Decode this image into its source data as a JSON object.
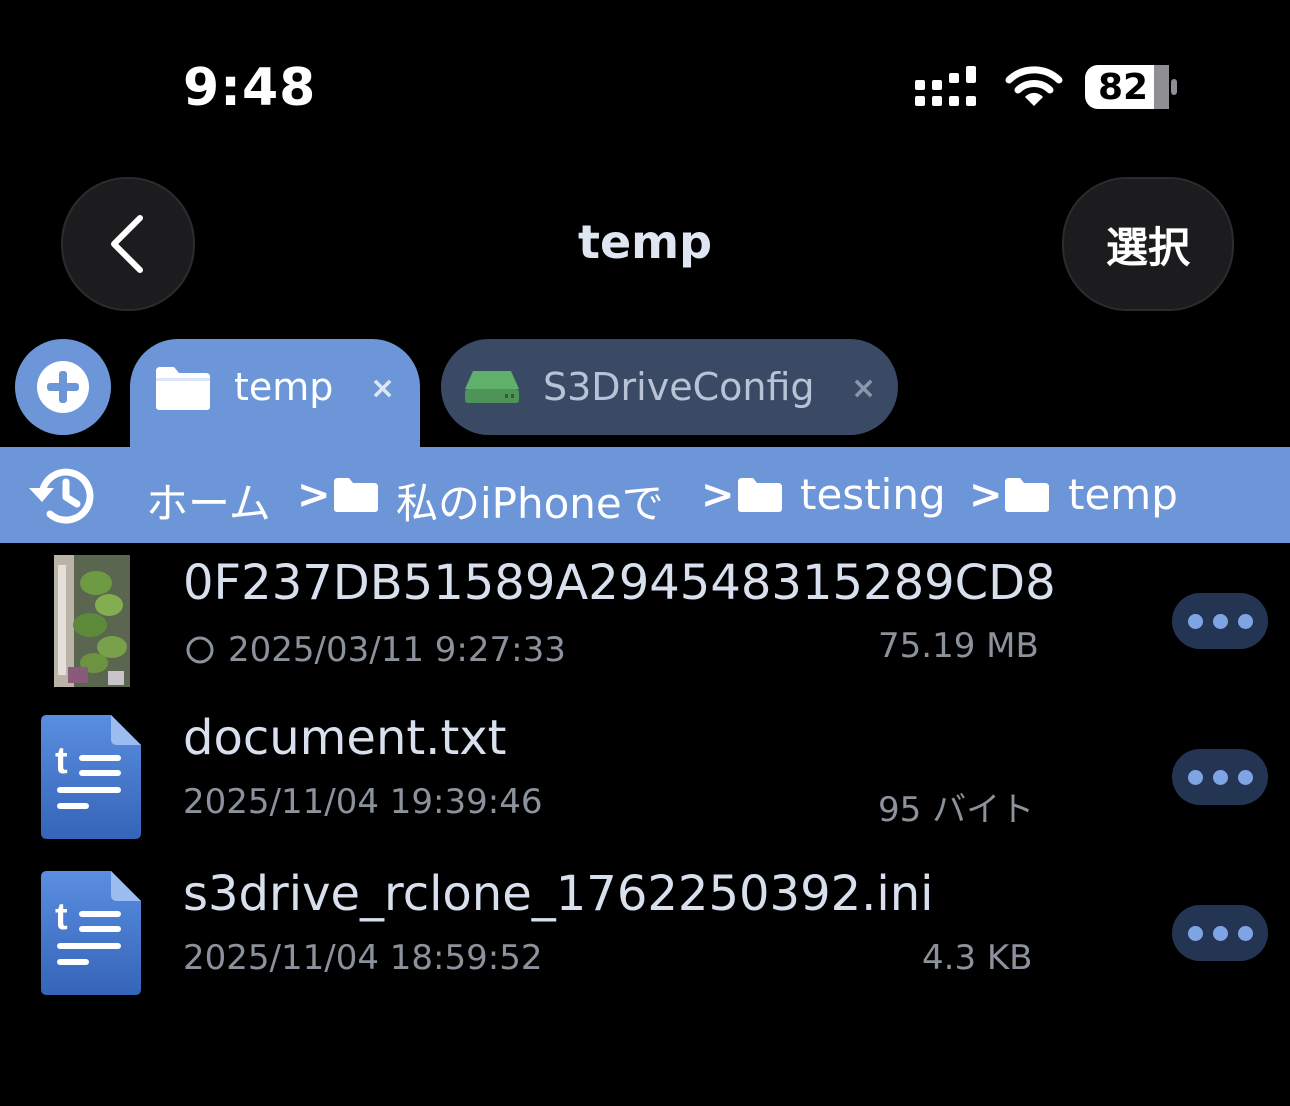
{
  "status_bar": {
    "time": "9:48",
    "battery_level": "82",
    "signal_icon": "signal-icon",
    "wifi_icon": "wifi-icon"
  },
  "nav": {
    "back_icon": "chevron-left-icon",
    "title": "temp",
    "select_label": "選択"
  },
  "tabs": {
    "add_icon": "plus-circle-icon",
    "items": [
      {
        "label": "temp",
        "icon": "folder-icon",
        "close": "×",
        "active": true
      },
      {
        "label": "S3DriveConfig",
        "icon": "drive-icon",
        "close": "×",
        "active": false
      }
    ]
  },
  "breadcrumb": {
    "history_icon": "history-icon",
    "items": [
      {
        "label": "ホーム"
      },
      {
        "label": "私のiPhoneで",
        "icon": "folder-icon"
      },
      {
        "label": "testing",
        "icon": "folder-icon"
      },
      {
        "label": "temp",
        "icon": "folder-icon"
      }
    ],
    "separator": ">"
  },
  "files": [
    {
      "name": "0F237DB51589A294548315289CD8",
      "date": "2025/03/11 9:27:33",
      "size": "75.19 MB",
      "thumb": "photo-thumbnail",
      "status_icon": "circle-outline-icon"
    },
    {
      "name": "document.txt",
      "date": "2025/11/04 19:39:46",
      "size": "95 バイト",
      "thumb": "text-file-icon"
    },
    {
      "name": "s3drive_rclone_1762250392.ini",
      "date": "2025/11/04 18:59:52",
      "size": "4.3 KB",
      "thumb": "text-file-icon"
    }
  ],
  "colors": {
    "accent": "#6d96d8",
    "tab_inactive": "#3a4a65",
    "more_button": "#233552",
    "background": "#000000"
  }
}
